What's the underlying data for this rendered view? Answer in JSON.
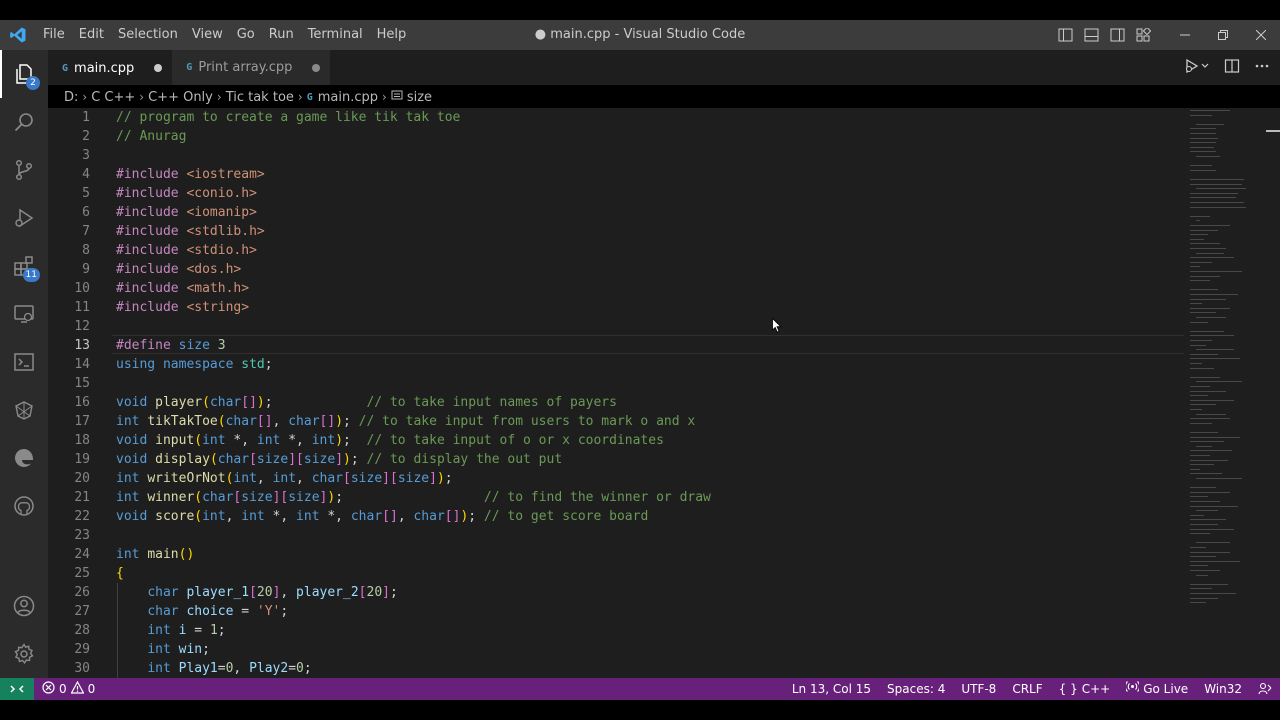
{
  "window": {
    "title": "● main.cpp - Visual Studio Code",
    "menu": [
      "File",
      "Edit",
      "Selection",
      "View",
      "Go",
      "Run",
      "Terminal",
      "Help"
    ]
  },
  "activity_bar": {
    "explorer_badge": "2",
    "extensions_badge": "11"
  },
  "tabs": [
    {
      "icon": "G",
      "label": "main.cpp",
      "active": true
    },
    {
      "icon": "G",
      "label": "Print array.cpp",
      "active": false
    }
  ],
  "breadcrumbs": {
    "parts": [
      "D:",
      "C C++",
      "C++ Only",
      "Tic tak toe"
    ],
    "file_icon": "G",
    "file": "main.cpp",
    "symbol": "size"
  },
  "code": {
    "line_numbers": [
      "1",
      "2",
      "3",
      "4",
      "5",
      "6",
      "7",
      "8",
      "9",
      "10",
      "11",
      "12",
      "13",
      "14",
      "15",
      "16",
      "17",
      "18",
      "19",
      "20",
      "21",
      "22",
      "23",
      "24",
      "25",
      "26",
      "27",
      "28",
      "29",
      "30"
    ],
    "l1": "// program to create a game like tik tak toe",
    "l2": "// Anurag",
    "l4": "<iostream>",
    "l5": "<conio.h>",
    "l6": "<iomanip>",
    "l7": "<stdlib.h>",
    "l8": "<stdio.h>",
    "l9": "<dos.h>",
    "l10": "<math.h>",
    "l11": "<string>",
    "include_kw": "#include",
    "define_kw": "#define",
    "define_name": "size",
    "define_val": "3",
    "l16_comment": "// to take input names of payers",
    "l17_comment": "// to take input from users to mark o and x",
    "l18_comment": "// to take input of o or x coordinates",
    "l19_comment": "// to display the out put",
    "l21_comment": "// to find the winner or draw",
    "l22_comment": "// to get score board"
  },
  "status_bar": {
    "errors": "0",
    "warnings": "0",
    "position": "Ln 13, Col 15",
    "spaces": "Spaces: 4",
    "encoding": "UTF-8",
    "eol": "CRLF",
    "language": "C++",
    "live": "Go Live",
    "platform": "Win32"
  }
}
